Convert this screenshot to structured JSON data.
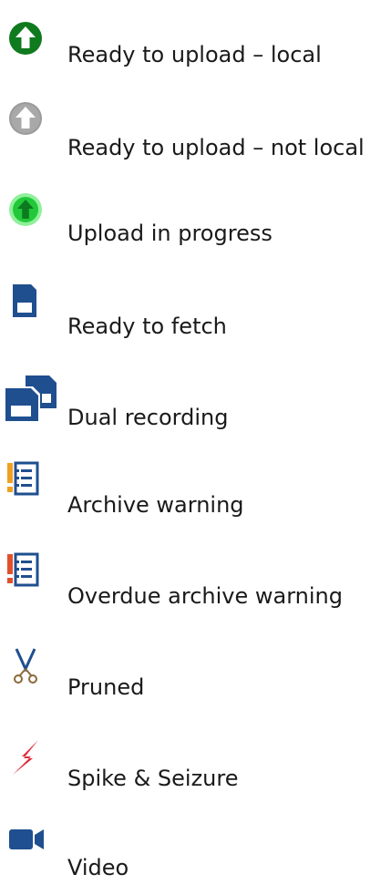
{
  "legend": {
    "items": [
      {
        "icon": "upload-local-icon",
        "label": "Ready to upload – local",
        "color": "#0f7a1e"
      },
      {
        "icon": "upload-not-local-icon",
        "label": "Ready to upload – not local",
        "color": "#9a9a9a"
      },
      {
        "icon": "upload-in-progress-icon",
        "label": "Upload in progress",
        "color": "#22c83a"
      },
      {
        "icon": "ready-to-fetch-icon",
        "label": "Ready to fetch",
        "color": "#1f4f8f"
      },
      {
        "icon": "dual-recording-icon",
        "label": "Dual recording",
        "color": "#1f4f8f"
      },
      {
        "icon": "archive-warning-icon",
        "label": "Archive warning",
        "color": "#f0a020"
      },
      {
        "icon": "overdue-archive-warning-icon",
        "label": "Overdue archive warning",
        "color": "#e2502b"
      },
      {
        "icon": "pruned-icon",
        "label": "Pruned",
        "color": "#1f4f8f"
      },
      {
        "icon": "spike-seizure-icon",
        "label": "Spike & Seizure",
        "color": "#e0283a"
      },
      {
        "icon": "video-icon",
        "label": "Video",
        "color": "#1f4f8f"
      }
    ]
  }
}
